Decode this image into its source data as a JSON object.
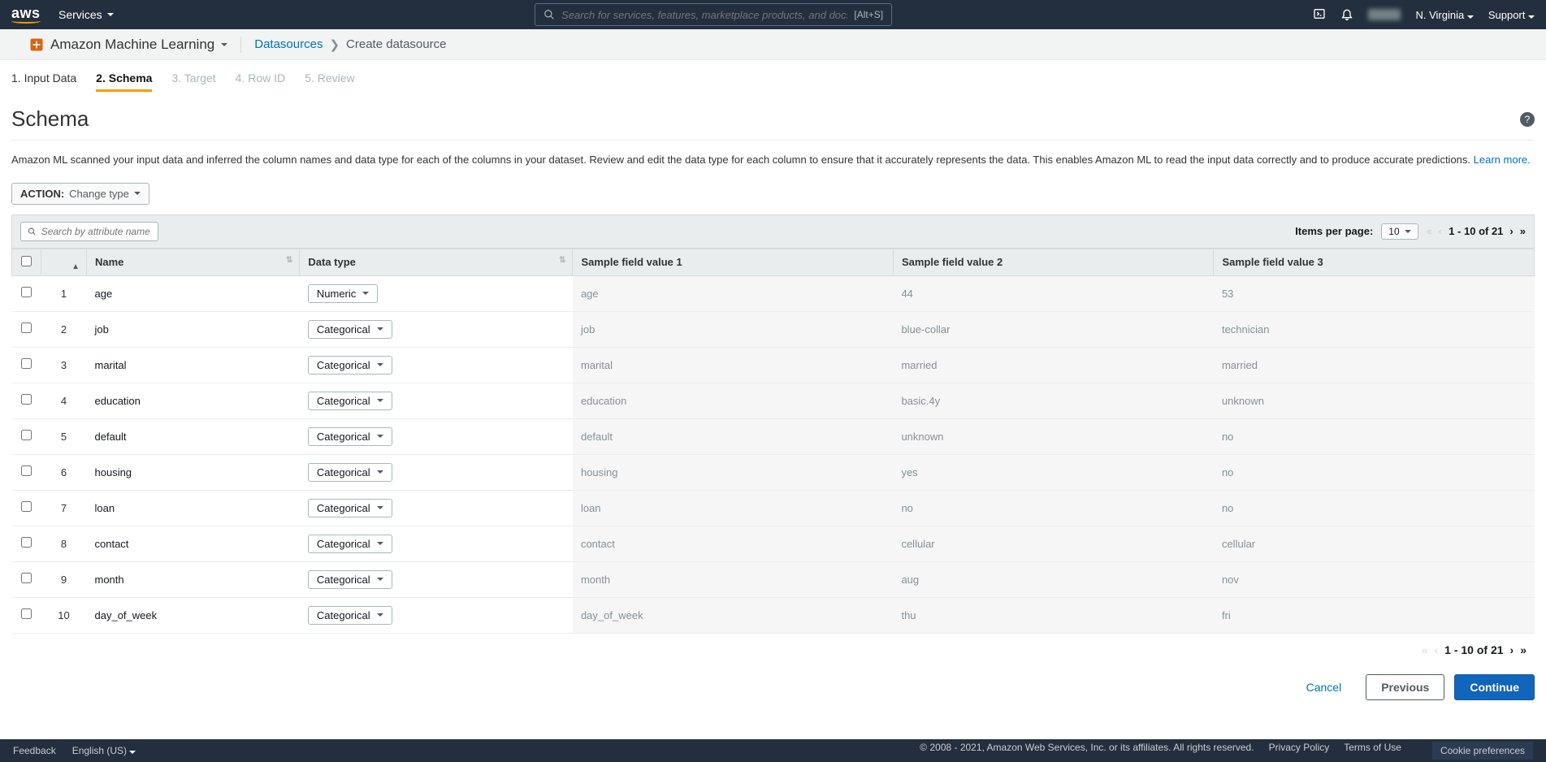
{
  "topnav": {
    "services_label": "Services",
    "search_placeholder": "Search for services, features, marketplace products, and docs",
    "shortcut": "[Alt+S]",
    "region": "N. Virginia",
    "support": "Support"
  },
  "breadcrumb": {
    "service_name": "Amazon Machine Learning",
    "link": "Datasources",
    "current": "Create datasource"
  },
  "steps": [
    {
      "label": "1. Input Data",
      "state": "done"
    },
    {
      "label": "2. Schema",
      "state": "active"
    },
    {
      "label": "3. Target",
      "state": "future"
    },
    {
      "label": "4. Row ID",
      "state": "future"
    },
    {
      "label": "5. Review",
      "state": "future"
    }
  ],
  "page": {
    "title": "Schema",
    "explain": "Amazon ML scanned your input data and inferred the column names and data type for each of the columns in your dataset. Review and edit the data type for each column to ensure that it accurately represents the data. This enables Amazon ML to read the input data correctly and to produce accurate predictions.",
    "learn_more": "Learn more."
  },
  "action": {
    "label": "ACTION:",
    "value": "Change type"
  },
  "controls": {
    "attr_search_placeholder": "Search by attribute name",
    "items_per_page_label": "Items per page:",
    "items_per_page_value": "10",
    "page_range": "1 - 10 of 21"
  },
  "table": {
    "headers": {
      "name": "Name",
      "datatype": "Data type",
      "s1": "Sample field value 1",
      "s2": "Sample field value 2",
      "s3": "Sample field value 3"
    },
    "rows": [
      {
        "idx": "1",
        "name": "age",
        "type": "Numeric",
        "s1": "age",
        "s2": "44",
        "s3": "53"
      },
      {
        "idx": "2",
        "name": "job",
        "type": "Categorical",
        "s1": "job",
        "s2": "blue-collar",
        "s3": "technician"
      },
      {
        "idx": "3",
        "name": "marital",
        "type": "Categorical",
        "s1": "marital",
        "s2": "married",
        "s3": "married"
      },
      {
        "idx": "4",
        "name": "education",
        "type": "Categorical",
        "s1": "education",
        "s2": "basic.4y",
        "s3": "unknown"
      },
      {
        "idx": "5",
        "name": "default",
        "type": "Categorical",
        "s1": "default",
        "s2": "unknown",
        "s3": "no"
      },
      {
        "idx": "6",
        "name": "housing",
        "type": "Categorical",
        "s1": "housing",
        "s2": "yes",
        "s3": "no"
      },
      {
        "idx": "7",
        "name": "loan",
        "type": "Categorical",
        "s1": "loan",
        "s2": "no",
        "s3": "no"
      },
      {
        "idx": "8",
        "name": "contact",
        "type": "Categorical",
        "s1": "contact",
        "s2": "cellular",
        "s3": "cellular"
      },
      {
        "idx": "9",
        "name": "month",
        "type": "Categorical",
        "s1": "month",
        "s2": "aug",
        "s3": "nov"
      },
      {
        "idx": "10",
        "name": "day_of_week",
        "type": "Categorical",
        "s1": "day_of_week",
        "s2": "thu",
        "s3": "fri"
      }
    ]
  },
  "wizard": {
    "cancel": "Cancel",
    "prev": "Previous",
    "next": "Continue"
  },
  "footer": {
    "feedback": "Feedback",
    "lang": "English (US)",
    "copyright": "© 2008 - 2021, Amazon Web Services, Inc. or its affiliates. All rights reserved.",
    "privacy": "Privacy Policy",
    "terms": "Terms of Use",
    "cookies": "Cookie preferences"
  }
}
